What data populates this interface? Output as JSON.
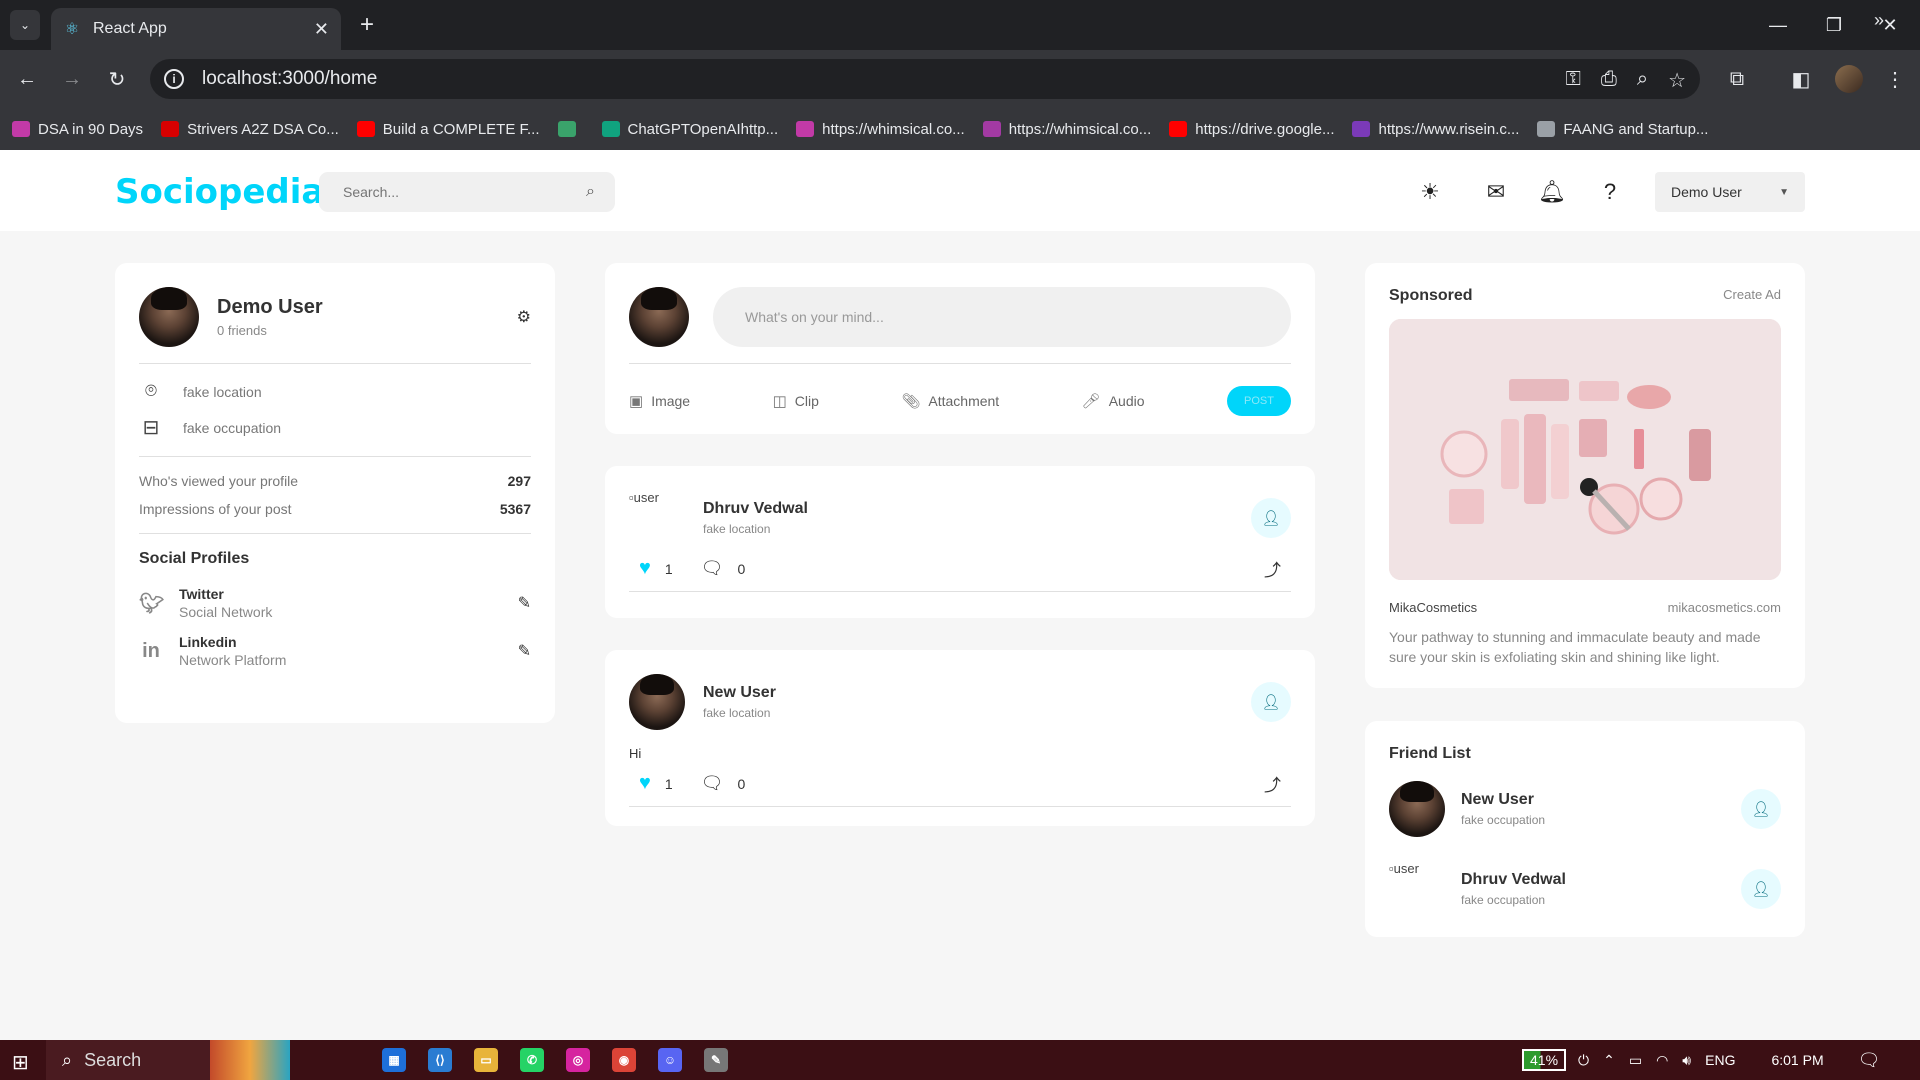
{
  "browser": {
    "tab_title": "React App",
    "url": "localhost:3000/home",
    "bookmarks": [
      {
        "label": "DSA in 90 Days",
        "color": "#c23aa7"
      },
      {
        "label": "Strivers A2Z DSA Co...",
        "color": "#d60000"
      },
      {
        "label": "Build a COMPLETE F...",
        "color": "#ff0000"
      },
      {
        "label": "",
        "color": "#3aa36b"
      },
      {
        "label": "ChatGPTOpenAIhttp...",
        "color": "#10a37f"
      },
      {
        "label": "https://whimsical.co...",
        "color": "#c23aa7"
      },
      {
        "label": "https://whimsical.co...",
        "color": "#a33aa3"
      },
      {
        "label": "https://drive.google...",
        "color": "#ff0000"
      },
      {
        "label": "https://www.risein.c...",
        "color": "#7b3ab8"
      },
      {
        "label": "FAANG and Startup...",
        "color": "#9aa0a6"
      }
    ]
  },
  "nav": {
    "logo": "Sociopedia",
    "search_placeholder": "Search...",
    "user_select": "Demo User"
  },
  "profile": {
    "name": "Demo User",
    "friends": "0 friends",
    "location": "fake location",
    "occupation": "fake occupation",
    "viewed_label": "Who's viewed your profile",
    "viewed_value": "297",
    "impressions_label": "Impressions of your post",
    "impressions_value": "5367",
    "social_title": "Social Profiles",
    "social": [
      {
        "name": "Twitter",
        "type": "Social Network"
      },
      {
        "name": "Linkedin",
        "type": "Network Platform"
      }
    ]
  },
  "composer": {
    "placeholder": "What's on your mind...",
    "actions": [
      "Image",
      "Clip",
      "Attachment",
      "Audio"
    ],
    "post_label": "POST"
  },
  "posts": [
    {
      "name": "Dhruv Vedwal",
      "location": "fake location",
      "text": "",
      "likes": "1",
      "comments": "0",
      "img_alt": "user"
    },
    {
      "name": "New User",
      "location": "fake location",
      "text": "Hi",
      "likes": "1",
      "comments": "0"
    }
  ],
  "ad": {
    "title": "Sponsored",
    "create": "Create Ad",
    "brand": "MikaCosmetics",
    "url": "mikacosmetics.com",
    "description": "Your pathway to stunning and immaculate beauty and made sure your skin is exfoliating skin and shining like light."
  },
  "friend_list": {
    "title": "Friend List",
    "friends": [
      {
        "name": "New User",
        "occupation": "fake occupation"
      },
      {
        "name": "Dhruv Vedwal",
        "occupation": "fake occupation",
        "img_alt": "user"
      }
    ]
  },
  "taskbar": {
    "search": "Search",
    "battery": "41%",
    "lang": "ENG",
    "time": "6:01 PM"
  }
}
